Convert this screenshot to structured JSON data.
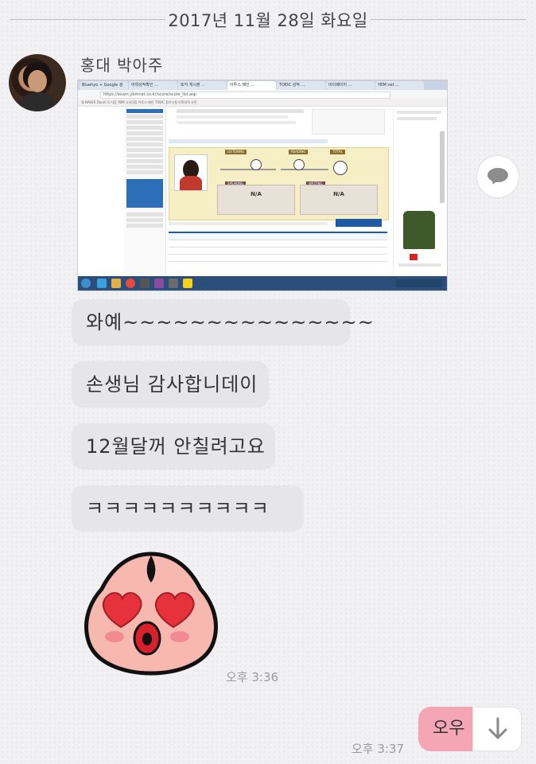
{
  "date_divider": "2017년 11월 28일 화요일",
  "sender": {
    "name": "홍대 박아주"
  },
  "screenshot": {
    "tabs": [
      "Bluehyo + Google 검",
      "어학성적확인 ...",
      "토익 게시판 ...",
      "이투스 메인 ...",
      "TOEIC 성적 ...",
      "마이페이지 ...",
      "YBM net ..."
    ],
    "url": "https://exam.ybmnet.co.kr/score/score_list.asp",
    "bookmarks": "앱   NAVER   Daum   G 다음   YBM 시사닷컴   이투스 메인   TOEIC 정기시험   어학성적 사전",
    "score_labels": {
      "listening": "LISTENING",
      "reading": "READING",
      "total": "TOTAL",
      "speaking": "SPEAKING",
      "writing": "WRITING"
    },
    "na1": "N/A",
    "na2": "N/A"
  },
  "messages": [
    {
      "text": "와예~~~~~~~~~~~~~~~"
    },
    {
      "text": "손생님 감사합니데이"
    },
    {
      "text": "12월달꺼 안칠려고요"
    },
    {
      "text": "ㅋㅋㅋㅋㅋㅋㅋㅋㅋㅋ"
    }
  ],
  "sticker": {
    "name": "apeach-heart-eyes-sticker"
  },
  "time_received": "오후 3:36",
  "my_message": "오우",
  "time_sent": "오후 3:37",
  "colors": {
    "background": "#f1f1f3",
    "received_bubble": "#e6e6e9",
    "sent_bubble": "#f5a6b5",
    "sticker_body": "#f7b8b0",
    "heart": "#e5323b"
  }
}
